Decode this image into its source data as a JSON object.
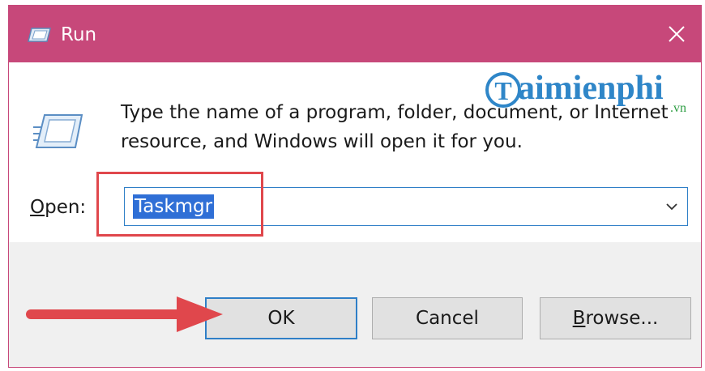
{
  "window": {
    "title": "Run",
    "close_label": "✕"
  },
  "watermark": {
    "brand": "aimienphi",
    "brand_initial": "T",
    "suffix": ".vn"
  },
  "body": {
    "description_line1": "Type the name of a program, folder, document, or Internet",
    "description_line2": "resource, and Windows will open it for you.",
    "open_label_accel": "O",
    "open_label_rest": "pen:",
    "open_value": "Taskmgr"
  },
  "buttons": {
    "ok": "OK",
    "cancel": "Cancel",
    "browse_accel": "B",
    "browse_rest": "rowse..."
  },
  "colors": {
    "titlebar": "#c7487a",
    "selection": "#2f6fd6",
    "annotation_red": "#e0474c",
    "focus_blue": "#2f7fc7"
  }
}
